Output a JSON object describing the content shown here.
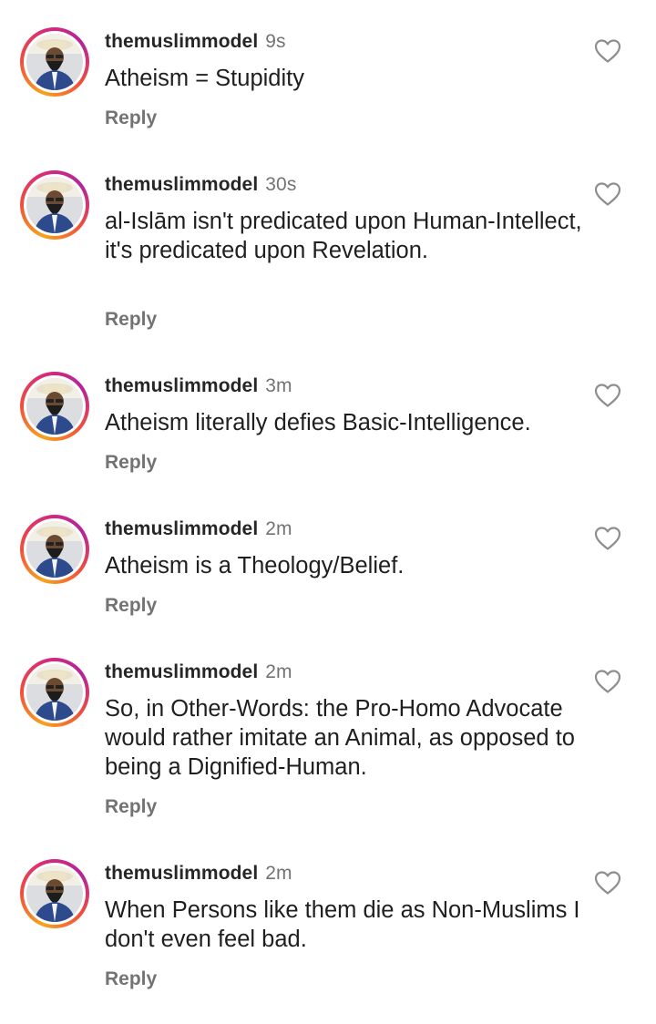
{
  "comments": [
    {
      "username": "themuslimmodel",
      "time": "9s",
      "text": "Atheism = Stupidity",
      "reply_label": "Reply"
    },
    {
      "username": "themuslimmodel",
      "time": "30s",
      "text": "al-Islām isn't predicated upon Human-Intellect, it's predicated upon Revelation.",
      "reply_label": "Reply"
    },
    {
      "username": "themuslimmodel",
      "time": "3m",
      "text": "Atheism literally defies Basic-Intelligence.",
      "reply_label": "Reply"
    },
    {
      "username": "themuslimmodel",
      "time": "2m",
      "text": "Atheism is a Theology/Belief.",
      "reply_label": "Reply"
    },
    {
      "username": "themuslimmodel",
      "time": "2m",
      "text": "So, in Other-Words: the Pro-Homo Advocate would rather imitate an Animal, as opposed to being a Dignified-Human.",
      "reply_label": "Reply"
    },
    {
      "username": "themuslimmodel",
      "time": "2m",
      "text": "When Persons like them die as Non-Muslims I don't even feel bad.",
      "reply_label": "Reply"
    }
  ],
  "icons": {
    "like": "heart-outline-icon",
    "avatar": "profile-photo"
  },
  "colors": {
    "username": "#262626",
    "meta": "#737373",
    "ring_gradient": [
      "#f7a31c",
      "#f04e3e",
      "#d62b7a",
      "#b4239a"
    ]
  }
}
